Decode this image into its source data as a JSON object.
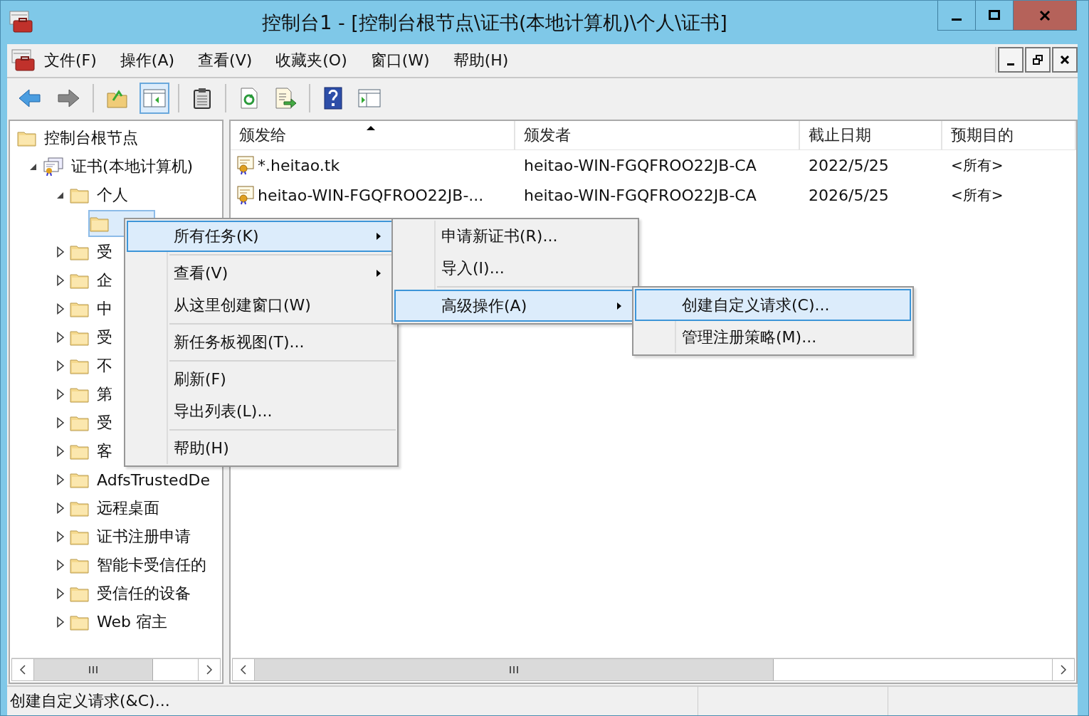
{
  "window": {
    "title": "控制台1 - [控制台根节点\\证书(本地计算机)\\个人\\证书]"
  },
  "menu_bar": [
    "文件(F)",
    "操作(A)",
    "查看(V)",
    "收藏夹(O)",
    "窗口(W)",
    "帮助(H)"
  ],
  "toolbar": [
    {
      "kind": "back",
      "pressed": false
    },
    {
      "kind": "forward",
      "pressed": false
    },
    {
      "kind": "separator"
    },
    {
      "kind": "up",
      "pressed": false
    },
    {
      "kind": "tree",
      "pressed": true
    },
    {
      "kind": "separator"
    },
    {
      "kind": "clipboard",
      "pressed": false
    },
    {
      "kind": "separator"
    },
    {
      "kind": "refresh",
      "pressed": false
    },
    {
      "kind": "export",
      "pressed": false
    },
    {
      "kind": "separator"
    },
    {
      "kind": "help",
      "pressed": false
    },
    {
      "kind": "pane",
      "pressed": false
    }
  ],
  "tree": [
    {
      "label": "控制台根节点",
      "kind": "folder",
      "children": [
        {
          "label": "证书(本地计算机)",
          "kind": "store",
          "expanded": true,
          "children": [
            {
              "label": "个人",
              "kind": "folder",
              "expanded": true,
              "children": [
                {
                  "kind": "folder",
                  "selected": true
                }
              ]
            },
            {
              "label": "受",
              "kind": "folder",
              "expanded": false
            },
            {
              "label": "企",
              "kind": "folder",
              "expanded": false
            },
            {
              "label": "中",
              "kind": "folder",
              "expanded": false
            },
            {
              "label": "受",
              "kind": "folder",
              "expanded": false
            },
            {
              "label": "不",
              "kind": "folder",
              "expanded": false
            },
            {
              "label": "第",
              "kind": "folder",
              "expanded": false
            },
            {
              "label": "受",
              "kind": "folder",
              "expanded": false
            },
            {
              "label": "客",
              "kind": "folder",
              "expanded": false
            },
            {
              "label": "AdfsTrustedDe",
              "kind": "folder",
              "expanded": false
            },
            {
              "label": "远程桌面",
              "kind": "folder",
              "expanded": false
            },
            {
              "label": "证书注册申请",
              "kind": "folder",
              "expanded": false
            },
            {
              "label": "智能卡受信任的",
              "kind": "folder",
              "expanded": false
            },
            {
              "label": "受信任的设备",
              "kind": "folder",
              "expanded": false
            },
            {
              "label": "Web 宿主",
              "kind": "folder",
              "expanded": false
            }
          ]
        }
      ]
    }
  ],
  "table": {
    "columns": [
      {
        "label": "颁发给",
        "sorted": true
      },
      {
        "label": "颁发者",
        "sorted": false
      },
      {
        "label": "截止日期",
        "sorted": false
      },
      {
        "label": "预期目的",
        "sorted": false
      }
    ],
    "rows": [
      [
        "*.heitao.tk",
        "heitao-WIN-FGQFROO22JB-CA",
        "2022/5/25",
        "<所有>"
      ],
      [
        "heitao-WIN-FGQFROO22JB-...",
        "heitao-WIN-FGQFROO22JB-CA",
        "2026/5/25",
        "<所有>"
      ]
    ]
  },
  "context_menu": {
    "items": [
      {
        "kind": "item",
        "label": "所有任务(K)",
        "submenu": true,
        "selected": true
      },
      {
        "kind": "separator"
      },
      {
        "kind": "item",
        "label": "查看(V)",
        "submenu": true,
        "selected": false
      },
      {
        "kind": "item",
        "label": "从这里创建窗口(W)",
        "submenu": false,
        "selected": false
      },
      {
        "kind": "separator"
      },
      {
        "kind": "item",
        "label": "新任务板视图(T)...",
        "submenu": false,
        "selected": false
      },
      {
        "kind": "separator"
      },
      {
        "kind": "item",
        "label": "刷新(F)",
        "submenu": false,
        "selected": false
      },
      {
        "kind": "item",
        "label": "导出列表(L)...",
        "submenu": false,
        "selected": false
      },
      {
        "kind": "separator"
      },
      {
        "kind": "item",
        "label": "帮助(H)",
        "submenu": false,
        "selected": false
      }
    ]
  },
  "submenu_all_tasks": {
    "items": [
      {
        "kind": "item",
        "label": "申请新证书(R)...",
        "submenu": false,
        "selected": false
      },
      {
        "kind": "item",
        "label": "导入(I)...",
        "submenu": false,
        "selected": false
      },
      {
        "kind": "separator"
      },
      {
        "kind": "item",
        "label": "高级操作(A)",
        "submenu": true,
        "selected": true
      }
    ]
  },
  "submenu_advanced": {
    "items": [
      {
        "kind": "item",
        "label": "创建自定义请求(C)...",
        "submenu": false,
        "selected": true
      },
      {
        "kind": "item",
        "label": "管理注册策略(M)...",
        "submenu": false,
        "selected": false
      }
    ]
  },
  "status_bar": {
    "text": "创建自定义请求(&C)..."
  }
}
